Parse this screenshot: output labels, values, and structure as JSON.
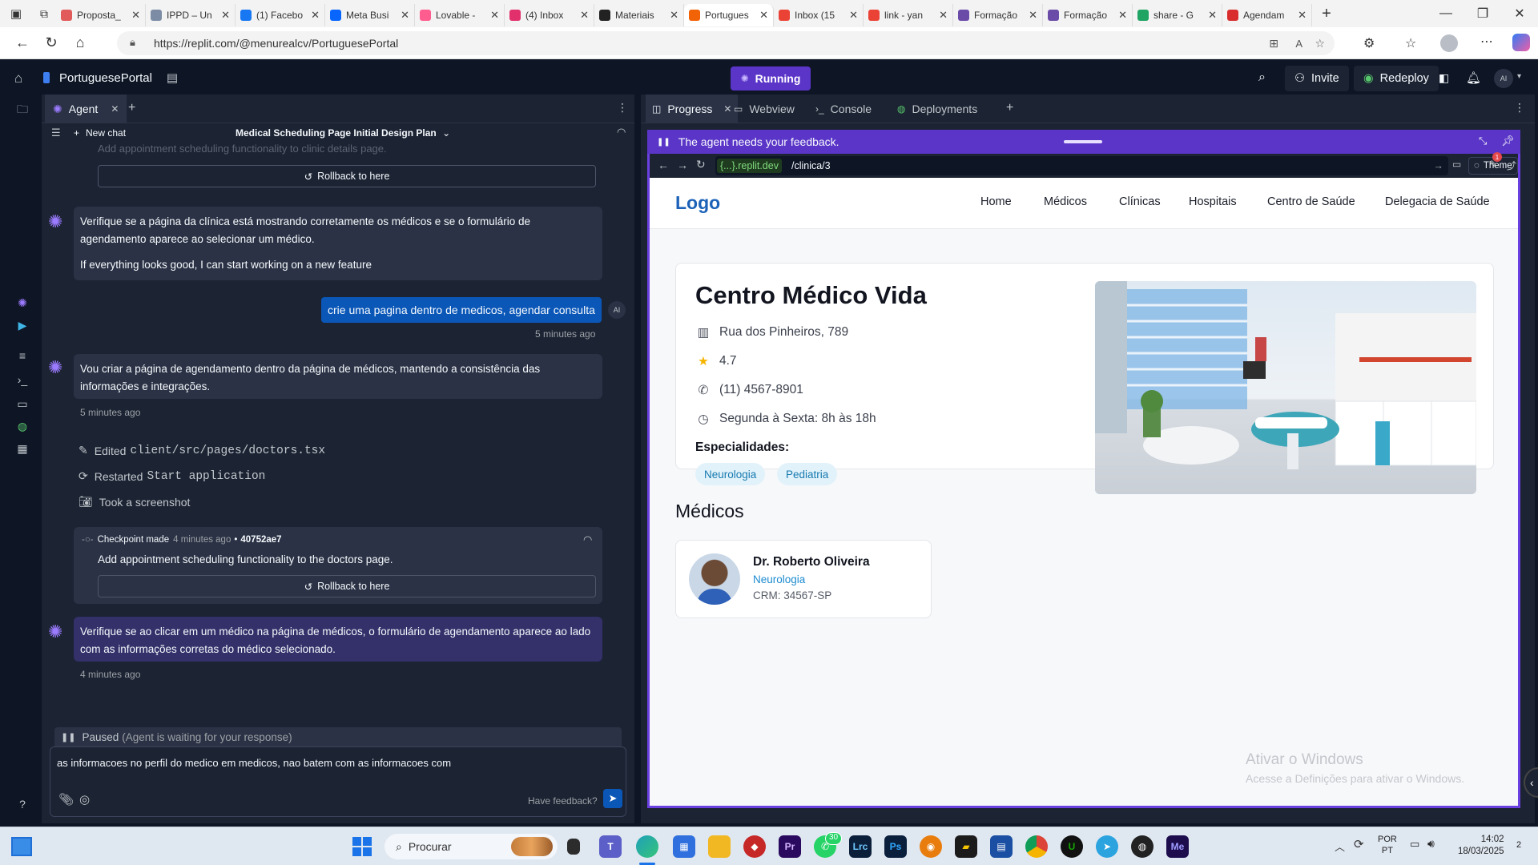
{
  "browser": {
    "tabs": [
      {
        "title": "Proposta_",
        "color": "#e15b5b"
      },
      {
        "title": "IPPD – Un",
        "color": "#7c8ca5"
      },
      {
        "title": "(1) Facebo",
        "color": "#1877f2"
      },
      {
        "title": "Meta Busi",
        "color": "#0866ff"
      },
      {
        "title": "Lovable -",
        "color": "#ff5d8f"
      },
      {
        "title": "(4) Inbox",
        "color": "#e1306c"
      },
      {
        "title": "Materiais",
        "color": "#222222"
      },
      {
        "title": "Portugues",
        "color": "#f26207",
        "active": true
      },
      {
        "title": "Inbox (15",
        "color": "#ea4335"
      },
      {
        "title": "link - yan",
        "color": "#ea4335"
      },
      {
        "title": "Formação",
        "color": "#6b4ba8"
      },
      {
        "title": "Formação",
        "color": "#6b4ba8"
      },
      {
        "title": "share - G",
        "color": "#1fa463"
      },
      {
        "title": "Agendam",
        "color": "#d92d2d"
      }
    ],
    "url": "https://replit.com/@menurealcv/PortuguesePortal"
  },
  "replit": {
    "project_name": "PortuguesePortal",
    "status": "Running",
    "invite": "Invite",
    "redeploy": "Redeploy",
    "avatar": "AI",
    "left_tab": "Agent",
    "new_chat": "New chat",
    "chat_title": "Medical Scheduling Page Initial Design Plan",
    "right_tabs": [
      "Progress",
      "Webview",
      "Console",
      "Deployments"
    ]
  },
  "chat": {
    "faded_text": "Add appointment scheduling functionality to clinic details page.",
    "rollback_label": "Rollback to here",
    "agent_msg1_p1": "Verifique se a página da clínica está mostrando corretamente os médicos e se o formulário de agendamento aparece ao selecionar um médico.",
    "agent_msg1_p2": "If everything looks good, I can start working on a new feature",
    "user_msg": "crie uma pagina dentro de medicos, agendar consulta",
    "user_avatar": "AI",
    "user_time": "5 minutes ago",
    "agent_msg2": "Vou criar a página de agendamento dentro da página de médicos, mantendo a consistência das informações e integrações.",
    "agent_msg2_time": "5 minutes ago",
    "action_edited_label": "Edited",
    "action_edited_value": "client/src/pages/doctors.tsx",
    "action_restarted_label": "Restarted",
    "action_restarted_value": "Start application",
    "action_screenshot": "Took a screenshot",
    "checkpoint_label": "Checkpoint made",
    "checkpoint_time": "4 minutes ago",
    "checkpoint_hash": "40752ae7",
    "checkpoint_desc": "Add appointment scheduling functionality to the doctors page.",
    "agent_msg3": "Verifique se ao clicar em um médico na página de médicos, o formulário de agendamento aparece ao lado com as informações corretas do médico selecionado.",
    "agent_msg3_time": "4 minutes ago",
    "paused_label": "Paused",
    "paused_detail": "(Agent is waiting for your response)",
    "input_text": "as informacoes no perfil do medico em medicos, nao batem com as informacoes com",
    "feedback_label": "Have feedback?"
  },
  "webview": {
    "banner": "The agent needs your feedback.",
    "domain": "{...}.replit.dev",
    "path": "/clinica/3",
    "theme_label": "Theme",
    "badge_count": "1",
    "site": {
      "logo": "Logo",
      "nav": [
        "Home",
        "Médicos",
        "Clínicas",
        "Hospitais",
        "Centro de Saúde",
        "Delegacia de Saúde"
      ],
      "clinic_name": "Centro Médico Vida",
      "address": "Rua dos Pinheiros, 789",
      "rating": "4.7",
      "phone": "(11) 4567-8901",
      "hours": "Segunda à Sexta: 8h às 18h",
      "specialties_label": "Especialidades:",
      "specialties": [
        "Neurologia",
        "Pediatria"
      ],
      "doctors_heading": "Médicos",
      "doctor_name": "Dr. Roberto Oliveira",
      "doctor_specialty": "Neurologia",
      "doctor_crm": "CRM: 34567-SP"
    },
    "watermark_title": "Ativar o Windows",
    "watermark_sub": "Acesse a Definições para ativar o Windows."
  },
  "taskbar": {
    "search": "Procurar",
    "lang1": "POR",
    "lang2": "PT",
    "time": "14:02",
    "date": "18/03/2025",
    "notif": "2",
    "whatsapp_badge": "30"
  }
}
